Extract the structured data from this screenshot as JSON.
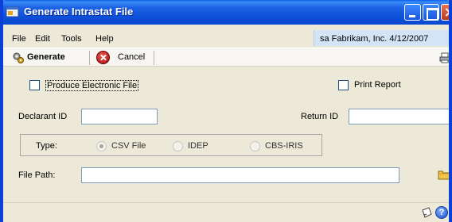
{
  "window": {
    "title": "Generate Intrastat File"
  },
  "menu": {
    "items": [
      "File",
      "Edit",
      "Tools",
      "Help"
    ],
    "session": "sa  Fabrikam, Inc.  4/12/2007"
  },
  "toolbar": {
    "generate_label": "Generate",
    "cancel_label": "Cancel"
  },
  "form": {
    "produce_electronic_label": "Produce Electronic File",
    "produce_electronic_checked": false,
    "print_report_label": "Print Report",
    "print_report_checked": false,
    "declarant_label": "Declarant ID",
    "declarant_value": "",
    "return_label": "Return ID",
    "return_value": "",
    "type_label": "Type:",
    "type_options": [
      "CSV File",
      "IDEP",
      "CBS-IRIS"
    ],
    "type_selected": "CSV File",
    "file_path_label": "File Path:",
    "file_path_value": ""
  },
  "icons": {
    "app": "app-window-icon",
    "generate": "gears-icon",
    "cancel": "cancel-icon",
    "print": "printer-icon",
    "folder": "folder-icon",
    "note": "note-icon",
    "help": "help-icon"
  },
  "colors": {
    "title_bar": "#0d4fd8",
    "dialog_bg": "#ece9d8",
    "session_bg": "#d4e4f7"
  }
}
